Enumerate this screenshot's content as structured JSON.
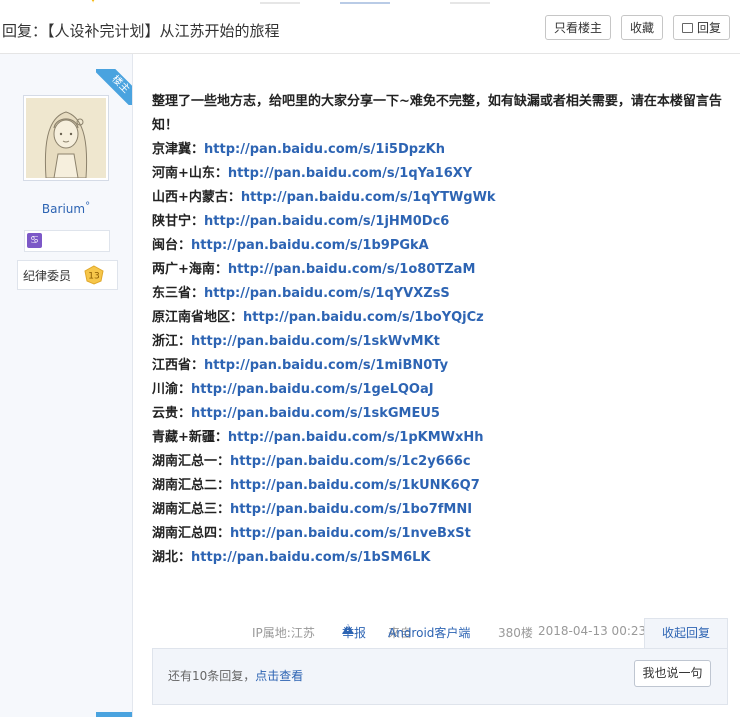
{
  "header": {
    "title_prefix": "回复：",
    "title": "【人设补完计划】从江苏开始的旅程",
    "only_owner_label": "只看楼主",
    "favorite_label": "收藏",
    "reply_label": "回复"
  },
  "author": {
    "badge": "楼主",
    "name": "Barium",
    "name_suffix": "°",
    "zodiac_symbol": "♋",
    "title": "纪律委员",
    "level": "13"
  },
  "post": {
    "intro": "整理了一些地方志，给吧里的大家分享一下~难免不完整，如有缺漏或者相关需要，请在本楼留言告知！",
    "links": [
      {
        "region": "京津冀：",
        "url": "http://pan.baidu.com/s/1i5DpzKh"
      },
      {
        "region": "河南+山东：",
        "url": "http://pan.baidu.com/s/1qYa16XY"
      },
      {
        "region": "山西+内蒙古：",
        "url": "http://pan.baidu.com/s/1qYTWgWk"
      },
      {
        "region": "陕甘宁：",
        "url": "http://pan.baidu.com/s/1jHM0Dc6"
      },
      {
        "region": "闽台：",
        "url": "http://pan.baidu.com/s/1b9PGkA"
      },
      {
        "region": "两广+海南：",
        "url": "http://pan.baidu.com/s/1o80TZaM"
      },
      {
        "region": "东三省：",
        "url": "http://pan.baidu.com/s/1qYVXZsS"
      },
      {
        "region": "原江南省地区：",
        "url": "http://pan.baidu.com/s/1boYQjCz"
      },
      {
        "region": "浙江：",
        "url": "http://pan.baidu.com/s/1skWvMKt"
      },
      {
        "region": "江西省：",
        "url": "http://pan.baidu.com/s/1miBN0Ty"
      },
      {
        "region": "川渝：",
        "url": "http://pan.baidu.com/s/1geLQOaJ"
      },
      {
        "region": "云贵：",
        "url": "http://pan.baidu.com/s/1skGMEU5"
      },
      {
        "region": "青藏+新疆：",
        "url": "http://pan.baidu.com/s/1pKMWxHh"
      },
      {
        "region": "湖南汇总一：",
        "url": "http://pan.baidu.com/s/1c2y666c"
      },
      {
        "region": "湖南汇总二：",
        "url": "http://pan.baidu.com/s/1kUNK6Q7"
      },
      {
        "region": "湖南汇总三：",
        "url": "http://pan.baidu.com/s/1bo7fMNI"
      },
      {
        "region": "湖南汇总四：",
        "url": "http://pan.baidu.com/s/1nveBxSt"
      },
      {
        "region": "湖北：",
        "url": "http://pan.baidu.com/s/1bSM6LK"
      }
    ]
  },
  "meta": {
    "ip": "IP属地:江苏",
    "report": "举报",
    "from_prefix": "来自",
    "client": "Android客户端",
    "floor": "380楼",
    "time": "2018-04-13 00:23",
    "collapse": "收起回复"
  },
  "replies": {
    "count_text": "还有10条回复，",
    "view_link": "点击查看",
    "say_button": "我也说一句"
  },
  "colors": {
    "link": "#2d64b3",
    "badge": "#4aa3df",
    "level_badge": "#f6c64a",
    "sidebar_bg": "#f6f8fc"
  }
}
